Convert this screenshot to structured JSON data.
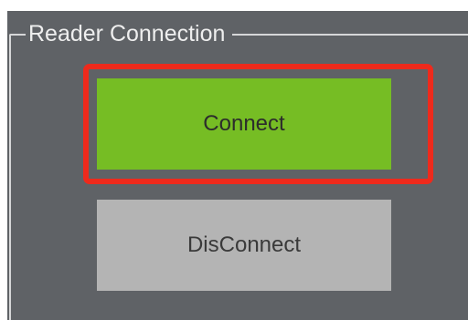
{
  "group": {
    "title": "Reader Connection"
  },
  "buttons": {
    "connect_label": "Connect",
    "disconnect_label": "DisConnect"
  },
  "colors": {
    "panel_background": "#5f6266",
    "connect_button": "#76bd24",
    "disconnect_button": "#b4b4b4",
    "highlight_border": "#ee2a1c"
  }
}
